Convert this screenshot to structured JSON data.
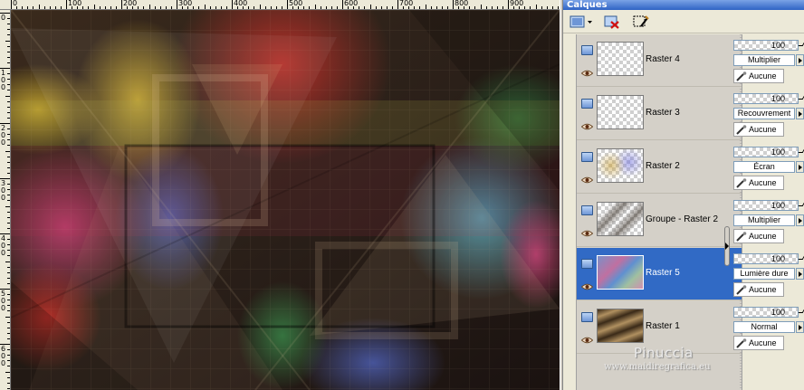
{
  "panel": {
    "title": "Calques"
  },
  "ruler": {
    "top_labels": [
      "0",
      "100",
      "200",
      "300",
      "400",
      "500",
      "600",
      "700",
      "800",
      "900"
    ],
    "left_labels": [
      [
        "0"
      ],
      [
        "1",
        "0",
        "0"
      ],
      [
        "2",
        "0",
        "0"
      ],
      [
        "3",
        "0",
        "0"
      ],
      [
        "4",
        "0",
        "0"
      ],
      [
        "5",
        "0",
        "0"
      ],
      [
        "6",
        "0",
        "0"
      ]
    ]
  },
  "layers": [
    {
      "name": "Raster 4",
      "opacity": "100",
      "blend": "Multiplier",
      "mask": "Aucune",
      "selected": false,
      "thumb": "checker"
    },
    {
      "name": "Raster 3",
      "opacity": "100",
      "blend": "Recouvrement",
      "mask": "Aucune",
      "selected": false,
      "thumb": "checker"
    },
    {
      "name": "Raster 2",
      "opacity": "100",
      "blend": "Écran",
      "mask": "Aucune",
      "selected": false,
      "thumb": "checker-color"
    },
    {
      "name": "Groupe - Raster 2",
      "opacity": "100",
      "blend": "Multiplier",
      "mask": "Aucune",
      "selected": false,
      "thumb": "checker-dark"
    },
    {
      "name": "Raster 5",
      "opacity": "100",
      "blend": "Lumière dure",
      "mask": "Aucune",
      "selected": true,
      "thumb": "gradient"
    },
    {
      "name": "Raster 1",
      "opacity": "100",
      "blend": "Normal",
      "mask": "Aucune",
      "selected": false,
      "thumb": "brown"
    }
  ],
  "toolbar": {
    "icons": [
      "new-layer-icon",
      "delete-layer-icon",
      "layer-properties-icon"
    ]
  },
  "watermark": {
    "name": "Pinuccia",
    "site": "www.maidiregrafica.eu"
  },
  "colors": {
    "selection": "#316ac5",
    "panel_bg": "#ece9d8",
    "title_bar": "#2f63c4"
  }
}
